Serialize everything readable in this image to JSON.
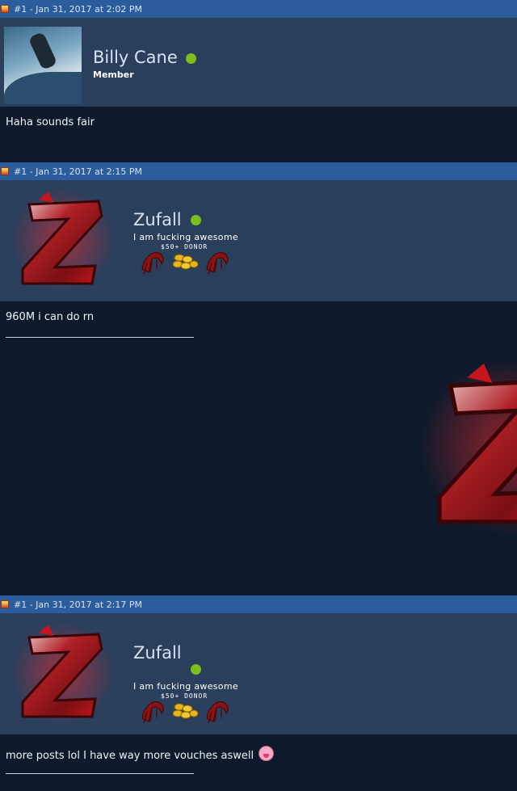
{
  "posts": [
    {
      "header": "#1 - Jan 31, 2017 at 2:02 PM",
      "username": "Billy Cane",
      "title": "Member",
      "avatar": "skateboarder-photo",
      "message": "Haha sounds fair"
    },
    {
      "header": "#1 - Jan 31, 2017 at 2:15 PM",
      "username": "Zufall",
      "title": "I am fucking awesome",
      "donor": "$50+ DONOR",
      "avatar": "red-z-logo",
      "message": "960M i can do rn"
    },
    {
      "header": "#1 - Jan 31, 2017 at 2:17 PM",
      "username": "Zufall",
      "title": "I am fucking awesome",
      "donor": "$50+ DONOR",
      "avatar": "red-z-logo",
      "message": "more posts lol I have way more vouches aswell"
    }
  ],
  "colors": {
    "header_bar": "#2b5c9c",
    "userbar": "#2a3f5c",
    "body": "#0e1a2b",
    "online": "#7dbf1a",
    "logo_red": "#c4161c"
  },
  "icons": [
    "post-flag-icon",
    "online-status-icon",
    "claw-badge-icon",
    "gold-coins-icon",
    "tongue-emoji-icon"
  ]
}
